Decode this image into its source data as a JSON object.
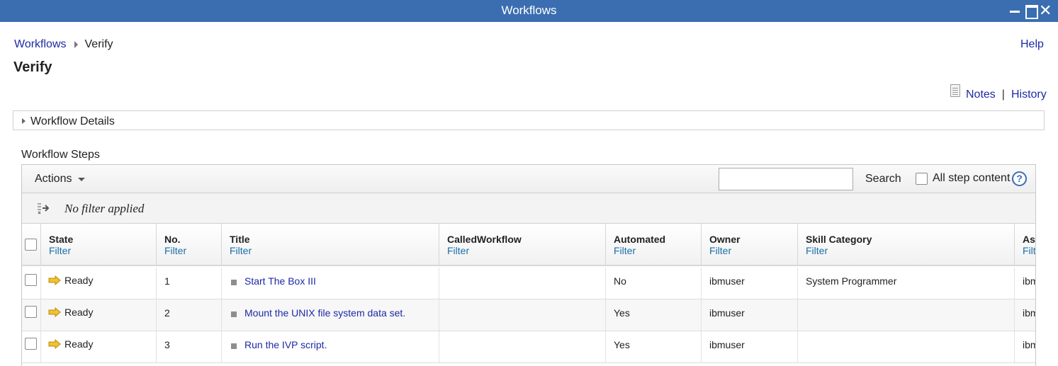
{
  "window": {
    "title": "Workflows"
  },
  "breadcrumb": {
    "root": "Workflows",
    "current": "Verify"
  },
  "help_label": "Help",
  "page_title": "Verify",
  "notes_label": "Notes",
  "history_label": "History",
  "notes_separator": "|",
  "details_label": "Workflow Details",
  "steps_label": "Workflow Steps",
  "toolbar": {
    "actions_label": "Actions",
    "search_value": "",
    "search_label": "Search",
    "all_step_label": "All step content",
    "help_glyph": "?"
  },
  "filter_status": "No filter applied",
  "columns": [
    {
      "name": "State",
      "filter": "Filter"
    },
    {
      "name": "No.",
      "filter": "Filter"
    },
    {
      "name": "Title",
      "filter": "Filter"
    },
    {
      "name": "CalledWorkflow",
      "filter": "Filter"
    },
    {
      "name": "Automated",
      "filter": "Filter"
    },
    {
      "name": "Owner",
      "filter": "Filter"
    },
    {
      "name": "Skill Category",
      "filter": "Filter"
    },
    {
      "name": "As",
      "filter": "Filt"
    }
  ],
  "rows": [
    {
      "state": "Ready",
      "no": "1",
      "title": "Start The Box III",
      "called": "",
      "automated": "No",
      "owner": "ibmuser",
      "skill": "System Programmer",
      "assignee": "ibm"
    },
    {
      "state": "Ready",
      "no": "2",
      "title": "Mount the UNIX file system data set.",
      "called": "",
      "automated": "Yes",
      "owner": "ibmuser",
      "skill": "",
      "assignee": "ibm"
    },
    {
      "state": "Ready",
      "no": "3",
      "title": "Run the IVP script.",
      "called": "",
      "automated": "Yes",
      "owner": "ibmuser",
      "skill": "",
      "assignee": "ibm"
    }
  ],
  "icons": {
    "state": "arrow-right-icon",
    "title": "step-square-icon",
    "filter": "filter-arrows-icon",
    "notes": "notes-icon"
  },
  "colors": {
    "titlebar": "#3b6eb0",
    "link": "#1d2aa5",
    "filter_link": "#1a6fa8",
    "ready_arrow": "#f2c12e"
  }
}
